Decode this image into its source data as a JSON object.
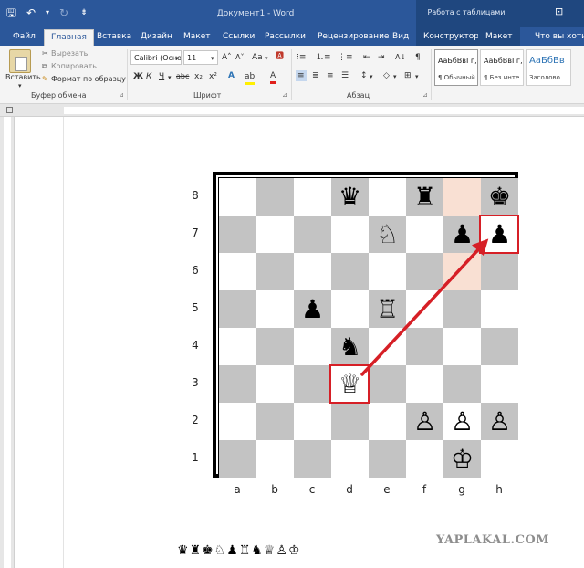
{
  "titlebar": {
    "doc_title": "Документ1 - Word",
    "context_title": "Работа с таблицами",
    "qat": {
      "save": "🖫",
      "undo": "↶",
      "undo_arrow": "▾",
      "redo": "↻",
      "customize": "⇟"
    },
    "window_control": "⊡"
  },
  "tabs": [
    "Файл",
    "Главная",
    "Вставка",
    "Дизайн",
    "Макет",
    "Ссылки",
    "Рассылки",
    "Рецензирование",
    "Вид",
    "Конструктор",
    "Макет",
    "Что вы хотите"
  ],
  "ribbon": {
    "clipboard": {
      "paste": "Вставить",
      "paste_arrow": "▾",
      "cut": "Вырезать",
      "copy": "Копировать",
      "format_painter": "Формат по образцу",
      "label": "Буфер обмена",
      "expander": "⊿"
    },
    "font": {
      "name": "Calibri (Осно",
      "size": "11",
      "dropdown": "▾",
      "grow": "A˄",
      "shrink": "A˅",
      "case": "Aa",
      "case_arrow": "▾",
      "clear": "🅰",
      "bold": "Ж",
      "italic": "К",
      "underline": "Ч",
      "underline_arrow": "▾",
      "strike": "abc",
      "subscript": "x₂",
      "superscript": "x²",
      "effects": "A",
      "highlight": "ab",
      "color": "A",
      "label": "Шрифт",
      "expander": "⊿"
    },
    "paragraph": {
      "bullets": "⁝≡",
      "numbering": "⒈≡",
      "multilevel": "⋮≡",
      "decrease": "⇤",
      "increase": "⇥",
      "sort": "A↓",
      "pilcrow": "¶",
      "align_left": "≡",
      "align_center": "≣",
      "align_right": "≡",
      "justify": "☰",
      "line_spacing": "↕",
      "shading": "◇",
      "borders": "⊞",
      "dropdown": "▾",
      "label": "Абзац",
      "expander": "⊿"
    },
    "styles": [
      {
        "sample": "АаБбВвГг,",
        "name": "¶ Обычный"
      },
      {
        "sample": "АаБбВвГг,",
        "name": "¶ Без инте..."
      },
      {
        "sample": "АаБбВв",
        "name": "Заголово..."
      }
    ]
  },
  "board": {
    "files": [
      "a",
      "b",
      "c",
      "d",
      "e",
      "f",
      "g",
      "h"
    ],
    "ranks": [
      "8",
      "7",
      "6",
      "5",
      "4",
      "3",
      "2",
      "1"
    ],
    "highlighted_squares": [
      "g8",
      "g6"
    ],
    "pieces": [
      {
        "square": "d8",
        "glyph": "♛",
        "name": "black-queen"
      },
      {
        "square": "f8",
        "glyph": "♜",
        "name": "black-rook"
      },
      {
        "square": "h8",
        "glyph": "♚",
        "name": "black-king"
      },
      {
        "square": "e7",
        "glyph": "♘",
        "name": "white-knight"
      },
      {
        "square": "g7",
        "glyph": "♟",
        "name": "black-pawn"
      },
      {
        "square": "h7",
        "glyph": "♟",
        "name": "black-pawn"
      },
      {
        "square": "c5",
        "glyph": "♟",
        "name": "black-pawn"
      },
      {
        "square": "e5",
        "glyph": "♖",
        "name": "white-rook"
      },
      {
        "square": "d4",
        "glyph": "♞",
        "name": "black-knight"
      },
      {
        "square": "d3",
        "glyph": "♕",
        "name": "white-queen"
      },
      {
        "square": "f2",
        "glyph": "♙",
        "name": "white-pawn"
      },
      {
        "square": "g2",
        "glyph": "♙",
        "name": "white-pawn"
      },
      {
        "square": "h2",
        "glyph": "♙",
        "name": "white-pawn"
      },
      {
        "square": "g1",
        "glyph": "♔",
        "name": "white-king"
      }
    ],
    "move": {
      "from": "d3",
      "to": "h7",
      "color": "#d61f26"
    }
  },
  "piece_symbols": "♛♜♚♘♟♖♞♕♙♔",
  "watermark": "YAPLAKAL.COM",
  "colors": {
    "word_blue": "#2b579a",
    "context_blue": "#1f477f",
    "dark_square": "#c3c3c3",
    "highlight_square": "#f9e0d3",
    "move_red": "#d61f26"
  }
}
